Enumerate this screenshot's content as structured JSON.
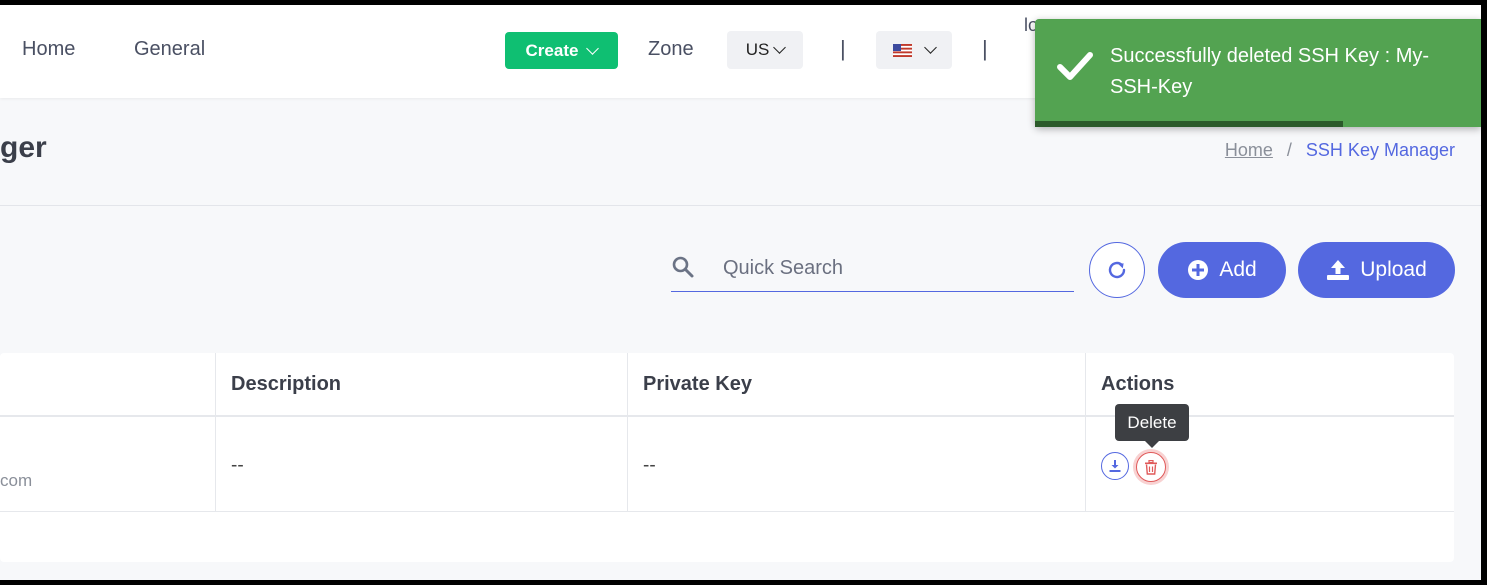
{
  "nav": {
    "home": "Home",
    "general": "General",
    "create_label": "Create",
    "zone_label": "Zone",
    "region_value": "US",
    "separator": "|",
    "partial_text": "lo"
  },
  "page": {
    "title_partial": "ger",
    "breadcrumb": {
      "home": "Home",
      "separator": "/",
      "current": "SSH Key Manager"
    }
  },
  "toolbar": {
    "search_placeholder": "Quick Search",
    "add_label": "Add",
    "upload_label": "Upload"
  },
  "table": {
    "headers": [
      "Description",
      "Private Key",
      "Actions"
    ],
    "rows": [
      {
        "email_partial": "com",
        "description": "--",
        "private_key": "--"
      }
    ],
    "tooltip": "Delete"
  },
  "toast": {
    "message": "Successfully deleted SSH Key : My-SSH-Key",
    "type": "success",
    "progress": 0.69
  },
  "colors": {
    "primary": "#5468e0",
    "create": "#0fbf72",
    "toast_success": "#53a351",
    "danger": "#e05a5a"
  }
}
